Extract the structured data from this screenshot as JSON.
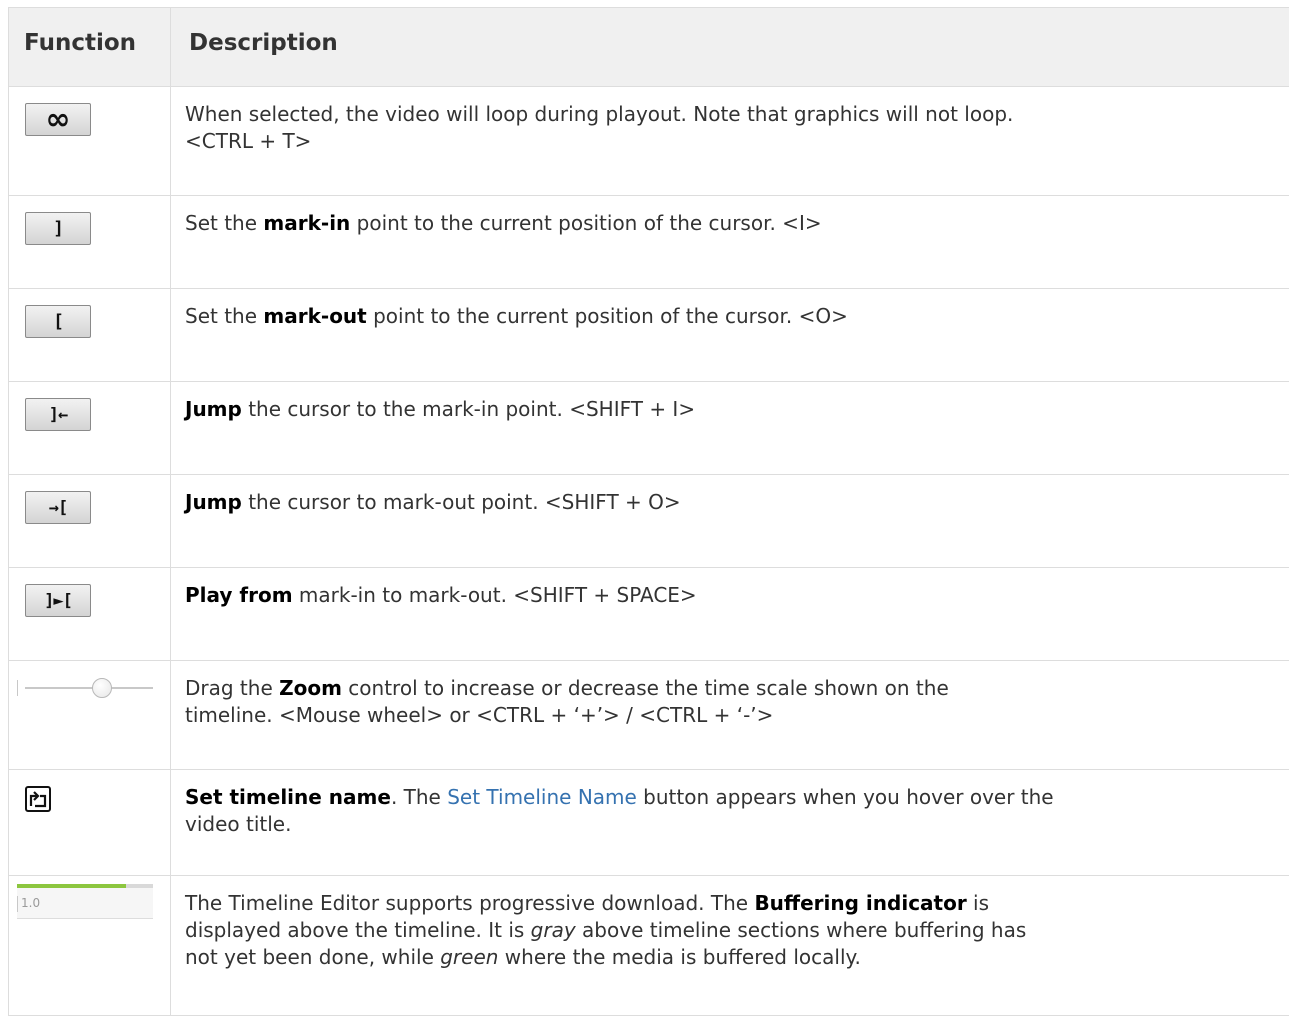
{
  "table": {
    "header": {
      "function": "Function",
      "description": "Description"
    },
    "rows": [
      {
        "icon": "loop-icon",
        "icon_glyph": "∞",
        "desc_1": "When selected, the video will loop during playout. Note that graphics will not loop.",
        "desc_2": "<CTRL + T>"
      },
      {
        "icon": "mark-in-icon",
        "icon_glyph": "]",
        "pre": "Set the ",
        "bold": "mark-in",
        "post": " point to the current position of the cursor. <I>"
      },
      {
        "icon": "mark-out-icon",
        "icon_glyph": "[",
        "pre": "Set the ",
        "bold": "mark-out",
        "post": " point to the current position of the cursor. <O>"
      },
      {
        "icon": "jump-to-mark-in-icon",
        "icon_glyph": "]←",
        "bold": "Jump",
        "post": " the cursor to the mark-in point. <SHIFT + I>"
      },
      {
        "icon": "jump-to-mark-out-icon",
        "icon_glyph": "→[",
        "bold": "Jump",
        "post": " the cursor to mark-out point. <SHIFT + O>"
      },
      {
        "icon": "play-mark-in-to-out-icon",
        "icon_glyph": "]►[",
        "bold": "Play from",
        "post": " mark-in to mark-out. <SHIFT + SPACE>"
      },
      {
        "icon": "zoom-slider-icon",
        "zoom_level": 0.62,
        "pre": "Drag the ",
        "bold": "Zoom",
        "post_1": " control to increase or decrease the time scale shown on the",
        "post_2": "timeline. <Mouse wheel> or <CTRL + ‘+’> / <CTRL + ‘-’>"
      },
      {
        "icon": "set-timeline-name-icon",
        "bold": "Set timeline name",
        "mid": ". The ",
        "link": "Set Timeline Name",
        "post_1": " button appears when you hover over the",
        "post_2": "video title."
      },
      {
        "icon": "buffering-indicator-icon",
        "buffer_label": "1.0",
        "buffer_fill": 0.8,
        "line1_pre": "The Timeline Editor supports progressive download. The ",
        "line1_bold": "Buffering indicator",
        "line1_post": " is",
        "line2_pre": "displayed above the timeline. It is ",
        "line2_italic": "gray",
        "line2_post": " above timeline sections where buffering has",
        "line3_pre": "not yet been done, while ",
        "line3_italic": "green",
        "line3_post": " where the media is buffered locally."
      }
    ]
  },
  "colors": {
    "link": "#3572b0",
    "header_bg": "#f0f0f0",
    "buffer_green": "#8cc63f"
  }
}
